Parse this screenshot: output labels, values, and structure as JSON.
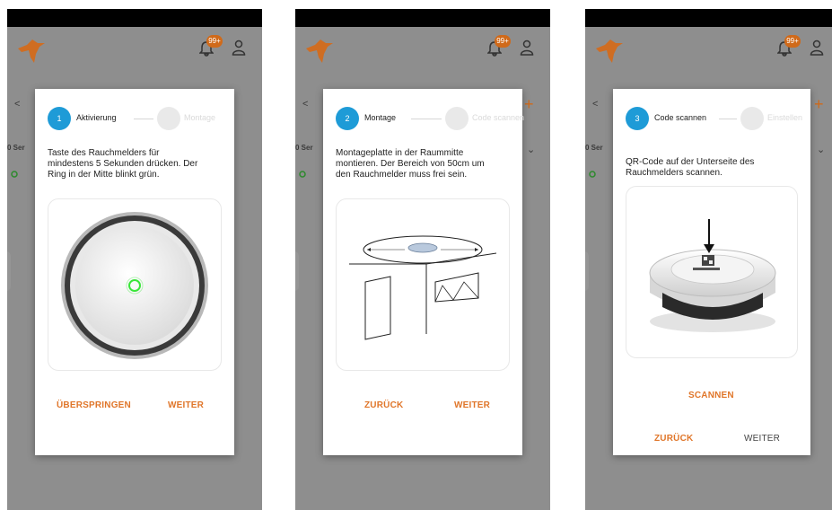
{
  "app": {
    "notification_badge": "99+",
    "accent_color": "#e0762a",
    "step_active_color": "#1e9bd7",
    "icons": [
      "logo-icon",
      "bell-icon",
      "user-icon",
      "chevron-left-icon",
      "plus-icon",
      "chevron-down-icon"
    ]
  },
  "background": {
    "list_count": "0 Ser"
  },
  "screens": [
    {
      "step_number": "1",
      "step_label": "Aktivierung",
      "next_step_label": "Montage",
      "description_lines": [
        "Taste des Rauchmelders für",
        "mindestens 5 Sekunden drücken. Der",
        "Ring in der Mitte blinkt grün."
      ],
      "buttons": {
        "left": "ÜBERSPRINGEN",
        "right": "WEITER"
      }
    },
    {
      "step_number": "2",
      "step_label": "Montage",
      "next_step_label": "Code scannen",
      "description_lines": [
        "Montageplatte in der Raummitte",
        "montieren. Der Bereich von 50cm um",
        "den Rauchmelder muss frei sein."
      ],
      "buttons": {
        "left": "ZURÜCK",
        "right": "WEITER"
      }
    },
    {
      "step_number": "3",
      "step_label": "Code scannen",
      "next_step_label": "Einstellen",
      "description_lines": [
        "QR-Code auf der Unterseite des",
        "Rauchmelders scannen."
      ],
      "buttons": {
        "scan": "SCANNEN",
        "left": "ZURÜCK",
        "right": "WEITER"
      }
    }
  ]
}
